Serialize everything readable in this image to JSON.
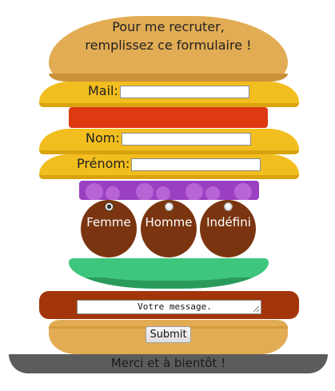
{
  "header": {
    "line1": "Pour me recruter,",
    "line2": "remplissez ce formulaire !"
  },
  "form": {
    "mail_label": "Mail:",
    "mail_value": "",
    "nom_label": "Nom:",
    "nom_value": "",
    "prenom_label": "Prénom:",
    "prenom_value": "",
    "gender_options": [
      {
        "label": "Femme",
        "checked": true
      },
      {
        "label": "Homme",
        "checked": false
      },
      {
        "label": "Indéfini",
        "checked": false
      }
    ],
    "message_placeholder": "Votre message.",
    "submit_label": "Submit"
  },
  "footer": {
    "thanks": "Merci et à bientôt !"
  },
  "colors": {
    "bun": "#e2ac54",
    "cheese": "#f2bd1e",
    "tomato": "#dd3a11",
    "onion": "#9b3fc2",
    "meat": "#7a3510",
    "lettuce": "#3ec67d",
    "bacon": "#a3350b",
    "plate": "#5c5c5c"
  }
}
